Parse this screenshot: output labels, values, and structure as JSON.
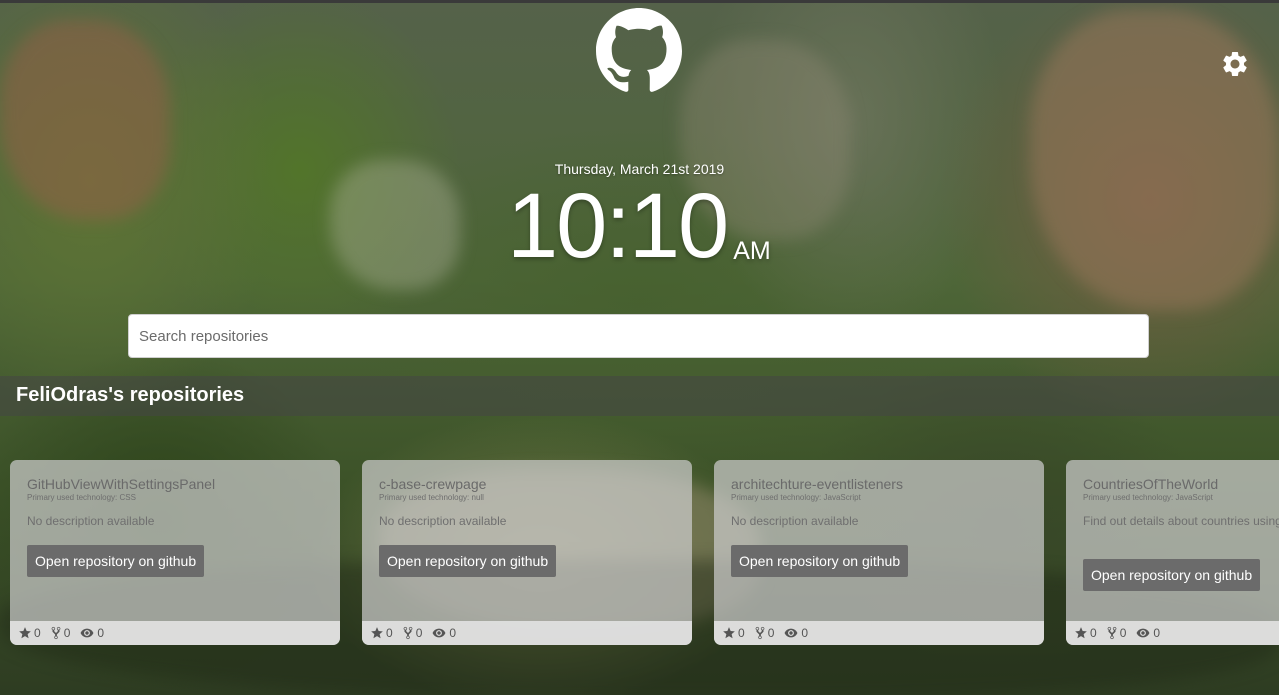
{
  "header": {
    "logo_icon": "github-octocat-icon",
    "settings_icon": "gear-icon"
  },
  "clock": {
    "date": "Thursday, March 21st 2019",
    "time": "10:10",
    "ampm": "AM"
  },
  "search": {
    "placeholder": "Search repositories",
    "value": ""
  },
  "section": {
    "title": "FeliOdras's repositories"
  },
  "repos": [
    {
      "name": "GitHubViewWithSettingsPanel",
      "tech": "Primary used technology: CSS",
      "description": "No description available",
      "button": "Open repository on github",
      "stars": "0",
      "forks": "0",
      "watchers": "0"
    },
    {
      "name": "c-base-crewpage",
      "tech": "Primary used technology: null",
      "description": "No description available",
      "button": "Open repository on github",
      "stars": "0",
      "forks": "0",
      "watchers": "0"
    },
    {
      "name": "architechture-eventlisteners",
      "tech": "Primary used technology: JavaScript",
      "description": "No description available",
      "button": "Open repository on github",
      "stars": "0",
      "forks": "0",
      "watchers": "0"
    },
    {
      "name": "CountriesOfTheWorld",
      "tech": "Primary used technology: JavaScript",
      "description": "Find out details about countries using API",
      "button": "Open repository on github",
      "stars": "0",
      "forks": "0",
      "watchers": "0"
    }
  ],
  "colors": {
    "card_bg": "#cccccc",
    "button_bg": "#6b6b6b",
    "text_white": "#ffffff"
  }
}
